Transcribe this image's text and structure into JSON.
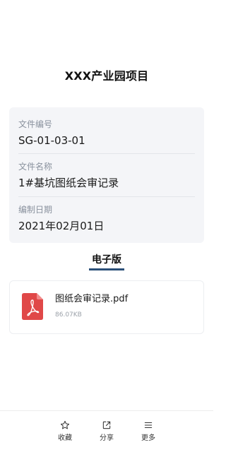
{
  "page": {
    "title": "XXX产业园项目"
  },
  "info": {
    "fields": [
      {
        "label": "文件编号",
        "value": "SG-01-03-01"
      },
      {
        "label": "文件名称",
        "value": "1#基坑图纸会审记录"
      },
      {
        "label": "编制日期",
        "value": "2021年02月01日"
      }
    ]
  },
  "section": {
    "tab_label": "电子版"
  },
  "file": {
    "icon": "pdf-file-icon",
    "name": "图纸会审记录.pdf",
    "size": "86.07KB"
  },
  "actions": [
    {
      "icon": "star-icon",
      "label": "收藏"
    },
    {
      "icon": "share-icon",
      "label": "分享"
    },
    {
      "icon": "menu-icon",
      "label": "更多"
    }
  ],
  "colors": {
    "accent": "#2b4f78",
    "pdf_red": "#e04848",
    "card_bg": "#f4f5f8"
  }
}
